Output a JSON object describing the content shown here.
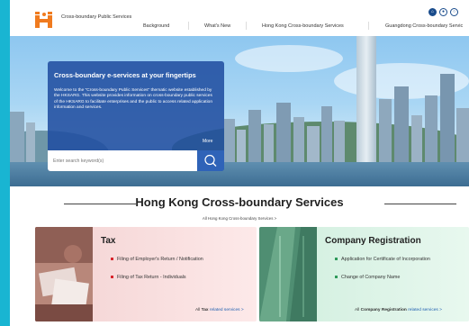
{
  "header": {
    "brand": "Cross-boundary Public Services",
    "nav": [
      "Background",
      "What's New",
      "Hong Kong Cross-boundary Services",
      "Guangdong Cross-boundary Servic"
    ]
  },
  "hero": {
    "title": "Cross-boundary e-services at your fingertips",
    "text": "Welcome to the \"Cross-boundary Public Services\" thematic website established by the HKSARG. This website provides information on cross-boundary public services of the HKSARG to facilitate enterprises and the public to access related application information and services.",
    "more": "More",
    "search_placeholder": "Enter search keyword(s)"
  },
  "services": {
    "title": "Hong Kong Cross-boundary Services",
    "all_link": "All Hong Kong Cross-boundary Services >"
  },
  "cards": {
    "tax": {
      "title": "Tax",
      "items": [
        "Filing of Employer's Return / Notification",
        "Filing of Tax Return - Individuals"
      ],
      "link_prefix": "All ",
      "link_bold": "Tax",
      "link_suffix": " related services >"
    },
    "company": {
      "title": "Company Registration",
      "items": [
        "Application for Certificate of Incorporation",
        "Change of Company Name"
      ],
      "link_prefix": "All ",
      "link_bold": "Company Registration",
      "link_suffix": " related services >"
    }
  },
  "colors": {
    "accent": "#19b5d2",
    "brand_orange": "#f07b1f",
    "panel_blue": "#214ea0",
    "tax_red": "#d9262c",
    "company_green": "#2f9a5a"
  },
  "icons": [
    "brand-logo-icon",
    "home-icon",
    "accessibility-icon",
    "language-icon",
    "search-icon"
  ]
}
